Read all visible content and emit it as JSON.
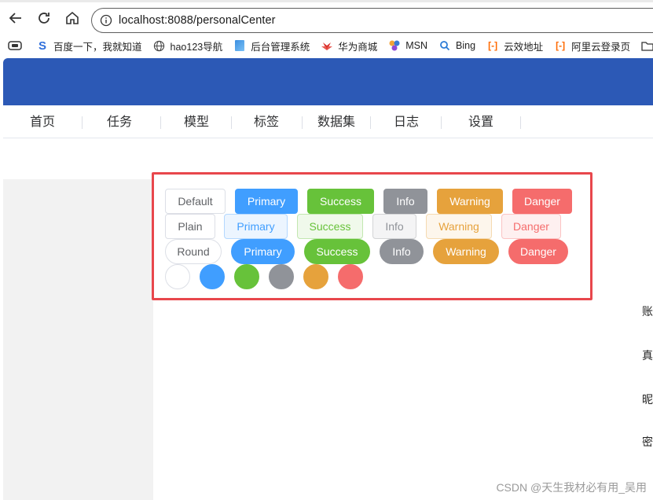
{
  "browser": {
    "url": "localhost:8088/personalCenter",
    "bookmarks": [
      {
        "label": "百度一下，我就知道",
        "icon": "baidu-icon",
        "color": "#2f6fdb"
      },
      {
        "label": "hao123导航",
        "icon": "globe-icon",
        "color": "#444444"
      },
      {
        "label": "后台管理系统",
        "icon": "page-icon",
        "color": "#3b8fe0"
      },
      {
        "label": "华为商城",
        "icon": "huawei-icon",
        "color": "#d9302c"
      },
      {
        "label": "MSN",
        "icon": "msn-icon",
        "color": "#3a7bd5"
      },
      {
        "label": "Bing",
        "icon": "search-icon",
        "color": "#2b7bd6"
      },
      {
        "label": "云效地址",
        "icon": "aliyun-icon",
        "color": "#ff6a00"
      },
      {
        "label": "阿里云登录页",
        "icon": "aliyun-icon",
        "color": "#ff6a00"
      }
    ]
  },
  "menu": {
    "items": [
      "首页",
      "任务",
      "模型",
      "标签",
      "数据集",
      "日志",
      "设置"
    ]
  },
  "buttons": {
    "default_row": [
      "Default",
      "Primary",
      "Success",
      "Info",
      "Warning",
      "Danger"
    ],
    "plain_row": [
      "Plain",
      "Primary",
      "Success",
      "Info",
      "Warning",
      "Danger"
    ],
    "round_row": [
      "Round",
      "Primary",
      "Success",
      "Info",
      "Warning",
      "Danger"
    ],
    "circle_count": 6
  },
  "right_edge_chars": [
    "账",
    "真",
    "昵",
    "密"
  ],
  "watermark": "CSDN @天生我材必有用_吴用",
  "colors": {
    "banner": "#2c59b6",
    "primary": "#409eff",
    "success": "#67c23a",
    "info": "#909399",
    "warning": "#e6a23c",
    "danger": "#f56c6c",
    "highlight": "#e8474c"
  }
}
